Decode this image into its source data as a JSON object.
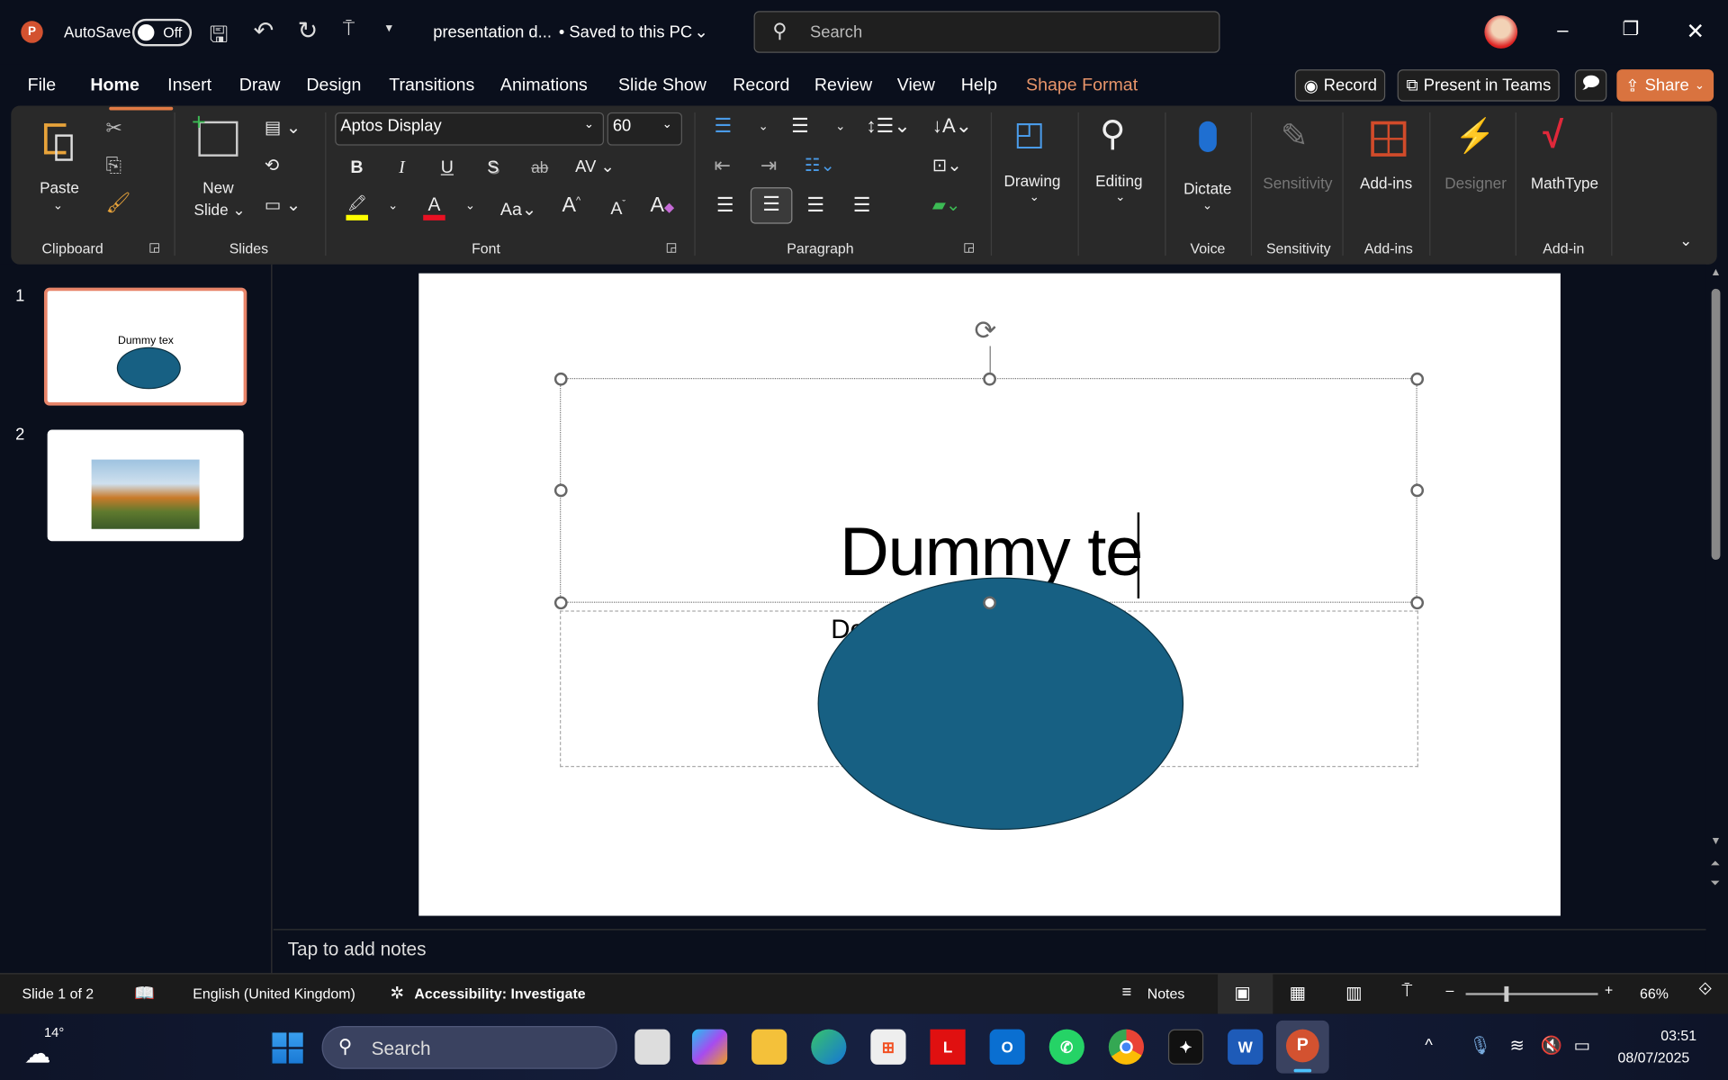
{
  "titlebar": {
    "autosave_label": "AutoSave",
    "autosave_state": "Off",
    "doc_title": "presentation d...",
    "save_status": "• Saved to this PC",
    "search_placeholder": "Search"
  },
  "tabs": [
    "File",
    "Home",
    "Insert",
    "Draw",
    "Design",
    "Transitions",
    "Animations",
    "Slide Show",
    "Record",
    "Review",
    "View",
    "Help",
    "Shape Format"
  ],
  "active_tab": "Home",
  "actions": {
    "record": "Record",
    "present": "Present in Teams",
    "share": "Share"
  },
  "ribbon": {
    "clipboard": {
      "paste": "Paste",
      "label": "Clipboard"
    },
    "slides": {
      "new_slide_1": "New",
      "new_slide_2": "Slide",
      "label": "Slides"
    },
    "font": {
      "font_name": "Aptos Display",
      "font_size": "60",
      "label": "Font",
      "bold": "B",
      "italic": "I",
      "underline": "U",
      "shadow": "S",
      "strike": "ab",
      "spacing": "AV",
      "case": "Aa",
      "grow": "A",
      "shrink": "A",
      "highlight_color": "#ffff00",
      "font_color": "#e81123"
    },
    "paragraph": {
      "label": "Paragraph"
    },
    "drawing": "Drawing",
    "editing": "Editing",
    "dictate": "Dictate",
    "voice_label": "Voice",
    "sensitivity": "Sensitivity",
    "sensitivity_label": "Sensitivity",
    "addins": "Add-ins",
    "addins_label": "Add-ins",
    "designer": "Designer",
    "mathtype": "MathType",
    "addin_label": "Add-in"
  },
  "thumbnails": [
    {
      "number": "1",
      "text": "Dummy tex"
    },
    {
      "number": "2"
    }
  ],
  "slide": {
    "title_text": "Dummy te",
    "subtitle_partial": "Do",
    "ellipse_color": "#176083"
  },
  "notes_placeholder": "Tap to add notes",
  "status": {
    "slide_pos": "Slide 1 of 2",
    "language": "English (United Kingdom)",
    "accessibility": "Accessibility: Investigate",
    "notes": "Notes",
    "zoom": "66%",
    "zoom_value": 66
  },
  "taskbar": {
    "weather": "14°",
    "search": "Search",
    "time": "03:51",
    "date": "08/07/2025"
  },
  "colors": {
    "accent": "#e07a45",
    "shape_format": "#e8956a"
  }
}
